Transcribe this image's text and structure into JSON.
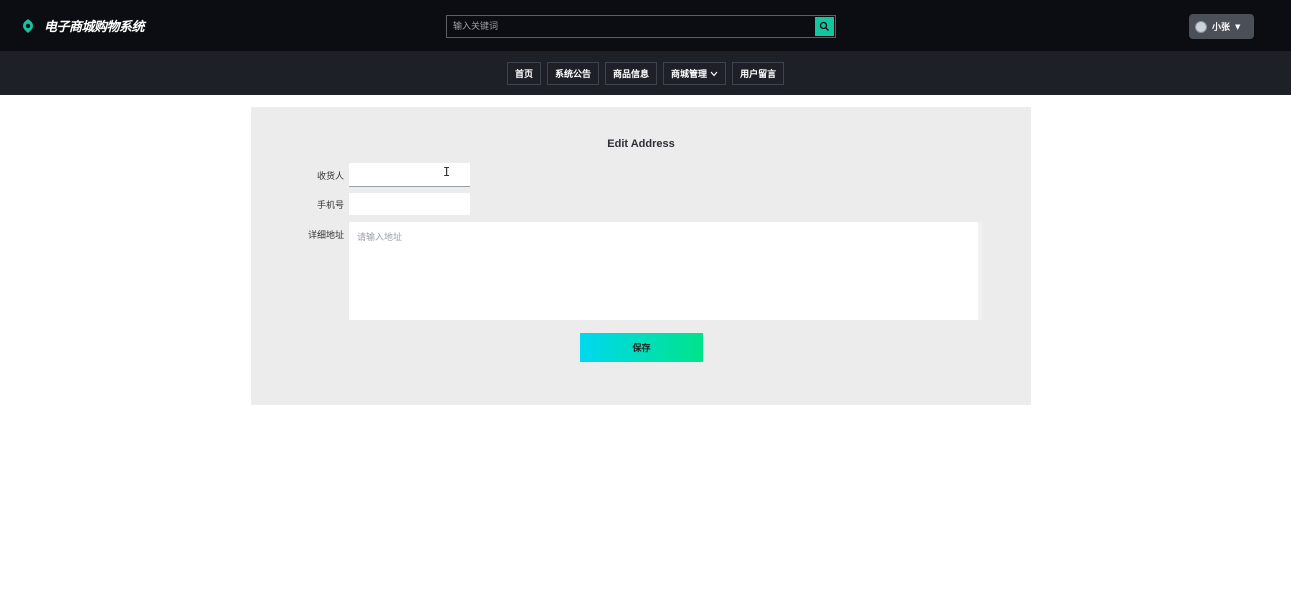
{
  "header": {
    "app_title": "电子商城购物系统",
    "logo_icon": "leaf-icon",
    "search": {
      "placeholder": "输入关键词",
      "value": "",
      "button_icon": "search-icon"
    },
    "user": {
      "name": "小张",
      "avatar_icon": "avatar-icon",
      "caret_icon": "caret-down-icon"
    }
  },
  "nav": {
    "items": [
      {
        "label": "首页"
      },
      {
        "label": "系统公告"
      },
      {
        "label": "商品信息"
      },
      {
        "label": "商城管理",
        "has_dropdown": true
      },
      {
        "label": "用户留言"
      }
    ]
  },
  "form": {
    "title": "Edit Address",
    "recipient": {
      "label": "收货人",
      "value": ""
    },
    "phone": {
      "label": "手机号",
      "value": ""
    },
    "address": {
      "label": "详细地址",
      "placeholder": "请输入地址",
      "value": ""
    },
    "save_label": "保存"
  },
  "colors": {
    "header_bg": "#0b0d12",
    "nav_bg": "#1d2027",
    "accent": "#12c6a0",
    "panel_bg": "#ececed",
    "save_gradient_start": "#00d8f0",
    "save_gradient_end": "#00e38a"
  }
}
